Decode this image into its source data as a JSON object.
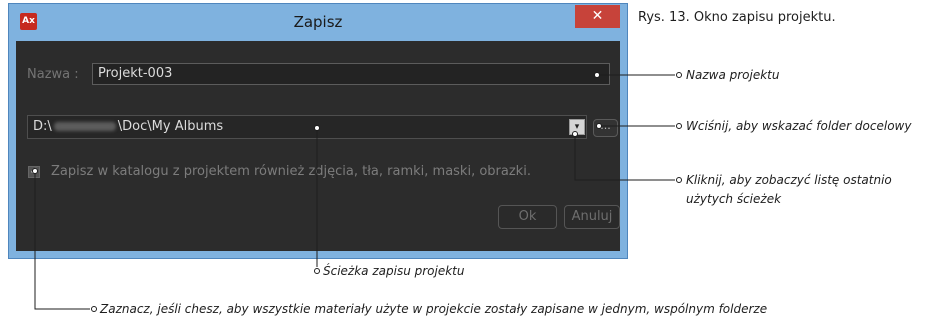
{
  "dialog": {
    "title": "Zapisz",
    "app_icon_text": "Ax",
    "close_glyph": "✕",
    "name_label": "Nazwa :",
    "name_value": "Projekt-003",
    "path_prefix": "D:\\",
    "path_suffix": "\\Doc\\My Albums",
    "browse_label": "...",
    "dropdown_glyph": "▾",
    "checkbox_checked": true,
    "checkbox_label": "Zapisz w katalogu z projektem również zdjęcia, tła, ramki, maski, obrazki.",
    "ok_label": "Ok",
    "cancel_label": "Anuluj"
  },
  "annotations": {
    "caption": "Rys. 13. Okno zapisu projektu.",
    "name_note": "Nazwa projektu",
    "browse_note": "Wciśnij, aby wskazać folder docelowy",
    "dropdown_note_line1": "Kliknij, aby zobaczyć listę ostatnio",
    "dropdown_note_line2": "użytych ścieżek",
    "path_note": "Ścieżka zapisu projektu",
    "checkbox_note": "Zaznacz, jeśli chesz, aby wszystkie materiały użyte w projekcie zostały zapisane w jednym, wspólnym folderze"
  },
  "colors": {
    "titlebar": "#7fb2df",
    "close_button": "#c7433a",
    "dialog_body": "#2c2c2c",
    "app_icon": "#c62a1f"
  }
}
